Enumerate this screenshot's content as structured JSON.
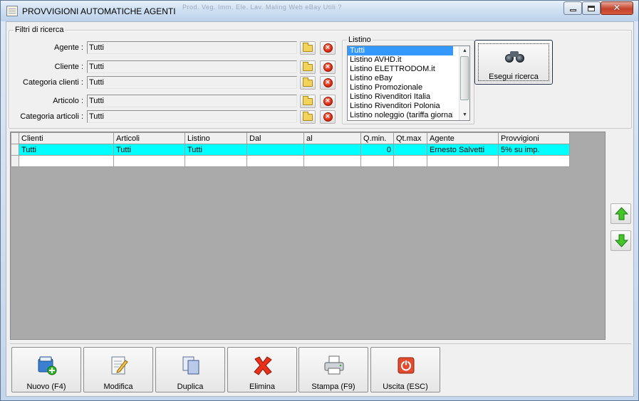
{
  "window": {
    "title": "PROVVIGIONI AUTOMATICHE AGENTI",
    "background_menu": "Prod.   Veg.   Imm.   Ele.   Lav.   Maling   Web   eBay   Utili   ?"
  },
  "filters": {
    "group_label": "Filtri di ricerca",
    "rows": [
      {
        "label": "Agente :",
        "value": "Tutti"
      },
      {
        "label": "Cliente :",
        "value": "Tutti"
      },
      {
        "label": "Categoria clienti :",
        "value": "Tutti"
      },
      {
        "label": "Articolo :",
        "value": "Tutti"
      },
      {
        "label": "Categoria articoli :",
        "value": "Tutti"
      }
    ]
  },
  "listino": {
    "group_label": "Listino",
    "items": [
      "Tutti",
      "Listino AVHD.it",
      "Listino ELETTRODOM.it",
      "Listino eBay",
      "Listino Promozionale",
      "Listino Rivenditori Italia",
      "Listino Rivenditori Polonia",
      "Listino noleggio (tariffa giornaliera)"
    ],
    "selected": "Tutti"
  },
  "search_button": {
    "label": "Esegui ricerca",
    "icon": "binoculars-icon"
  },
  "grid": {
    "columns": [
      "Clienti",
      "Articoli",
      "Listino",
      "Dal",
      "al",
      "Q.min.",
      "Qt.max",
      "Agente",
      "Provvigioni"
    ],
    "rows": [
      [
        "Tutti",
        "Tutti",
        "Tutti",
        "",
        "",
        "0",
        "",
        "Ernesto Salvetti",
        "5% su imp."
      ],
      [
        "",
        "",
        "",
        "",
        "",
        "",
        "",
        "",
        ""
      ]
    ]
  },
  "side_buttons": {
    "up": "arrow-up-icon",
    "down": "arrow-down-icon"
  },
  "actions": [
    {
      "label": "Nuovo (F4)",
      "icon": "new-record-icon"
    },
    {
      "label": "Modifica",
      "icon": "edit-icon"
    },
    {
      "label": "Duplica",
      "icon": "duplicate-icon"
    },
    {
      "label": "Elimina",
      "icon": "delete-icon"
    },
    {
      "label": "Stampa (F9)",
      "icon": "printer-icon"
    },
    {
      "label": "Uscita (ESC)",
      "icon": "exit-icon"
    }
  ],
  "colors": {
    "selected_row": "#00ffff",
    "list_selection": "#3399ff",
    "grid_background": "#aaaaaa"
  }
}
